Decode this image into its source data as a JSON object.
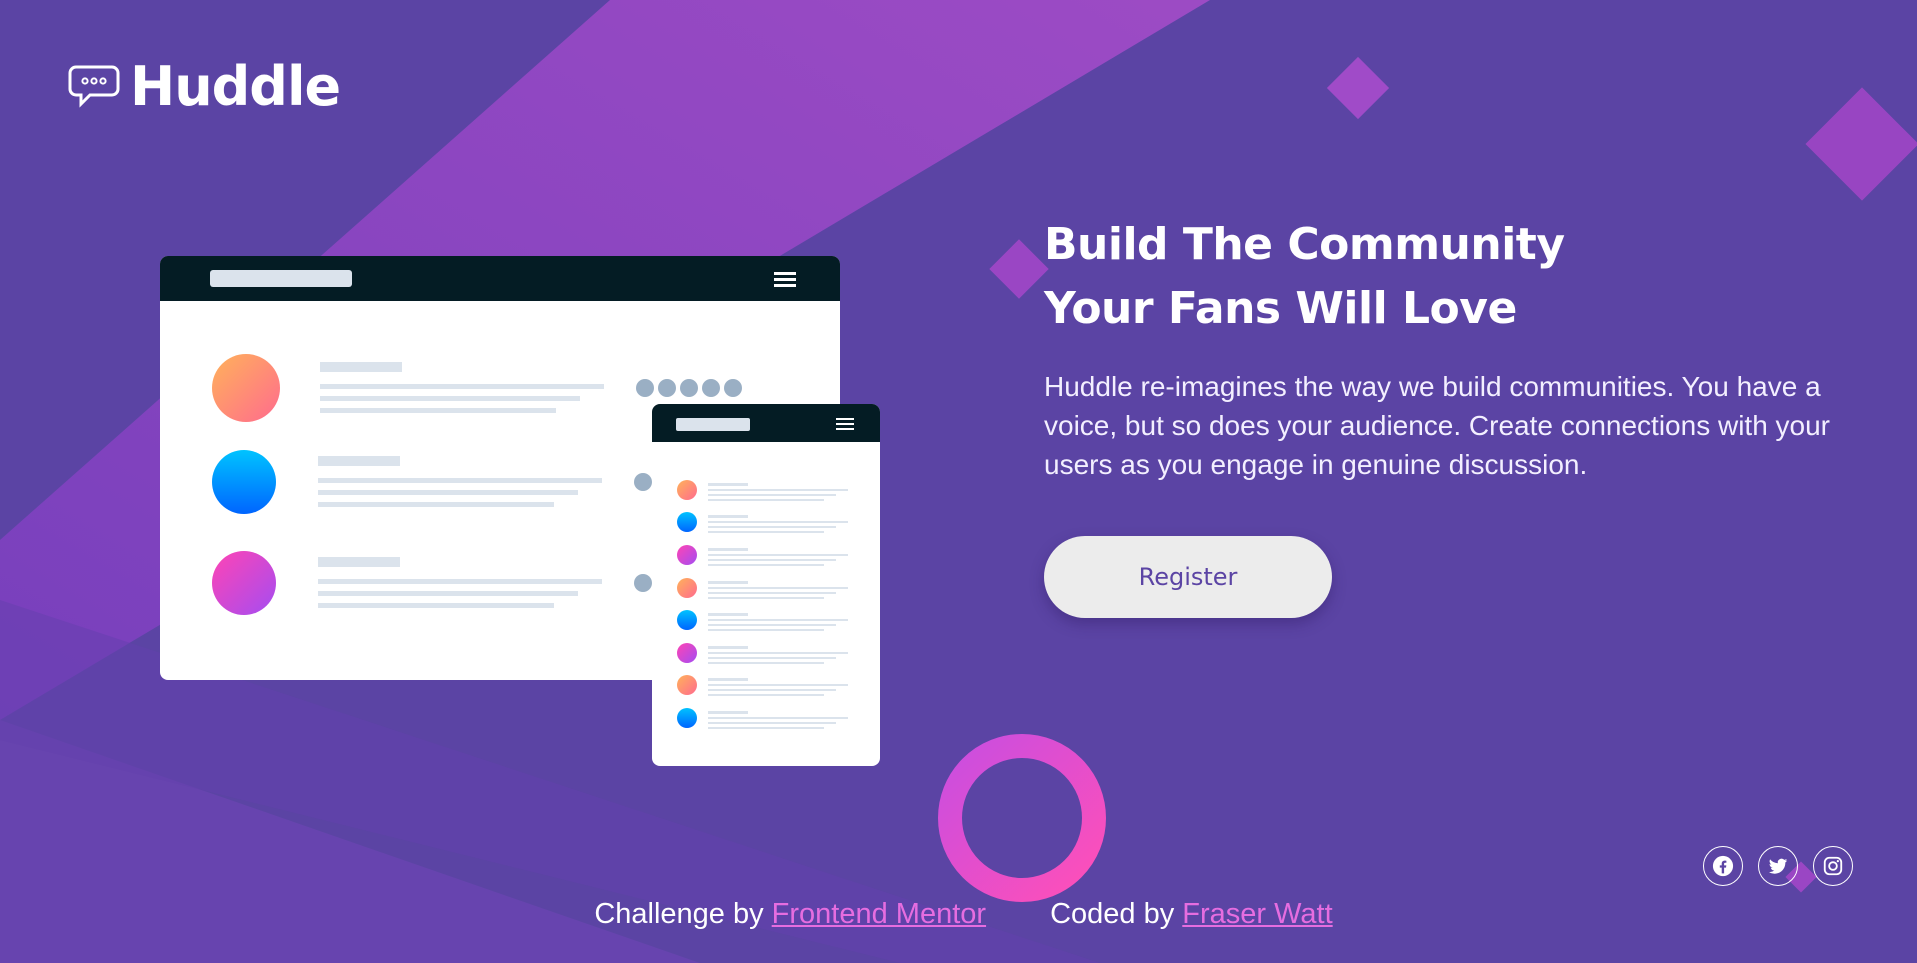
{
  "brand": {
    "name": "Huddle",
    "icon": "chat-bubble-icon"
  },
  "hero": {
    "title_line1": "Build The Community",
    "title_line2": "Your Fans Will Love",
    "description": "Huddle re-imagines the way we build communities. You have a voice, but so does your audience. Create connections with your users as you engage in genuine discussion.",
    "register_label": "Register"
  },
  "social": {
    "items": [
      "facebook-icon",
      "twitter-icon",
      "instagram-icon"
    ]
  },
  "footer": {
    "challenge_prefix": "Challenge by",
    "challenge_link": "Frontend Mentor",
    "coded_prefix": "Coded by",
    "coded_link": "Fraser Watt"
  },
  "colors": {
    "background": "#5b44a4",
    "accent": "#e66de0",
    "button_bg": "#ececec",
    "button_text": "#5b44a4"
  }
}
